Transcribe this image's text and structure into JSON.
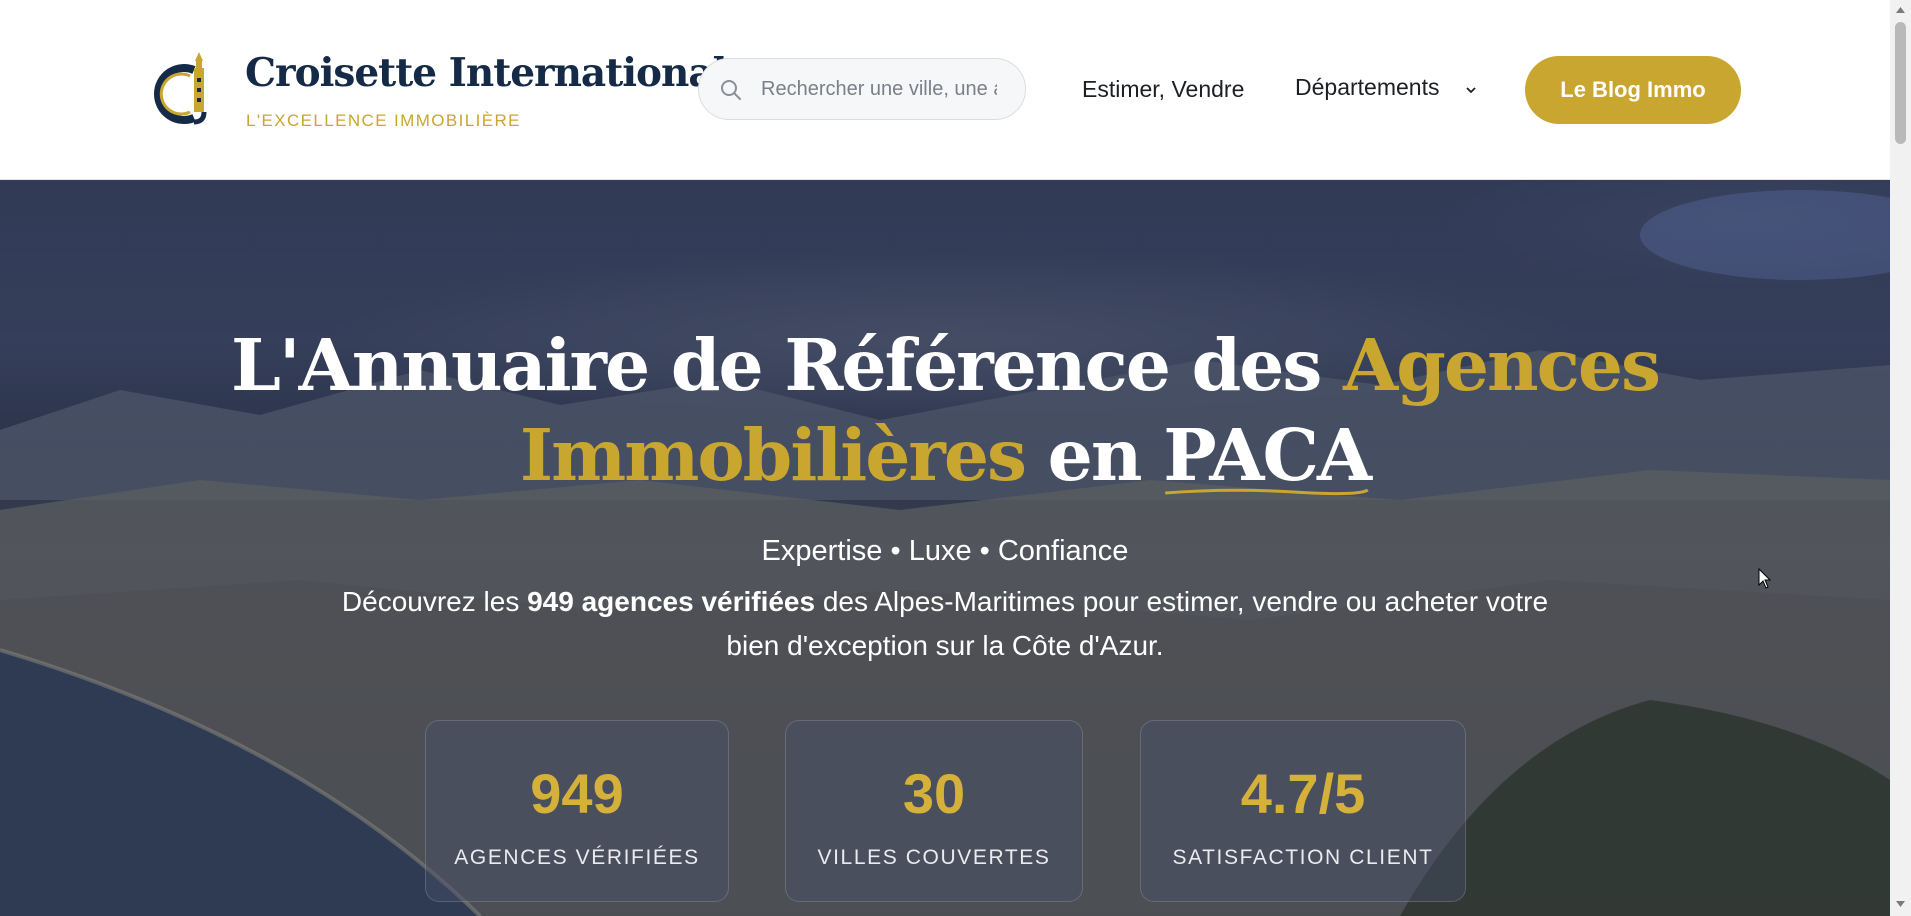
{
  "header": {
    "brand_name": "Croisette International",
    "brand_tagline": "L'EXCELLENCE IMMOBILIÈRE",
    "logo_letters": "CI",
    "search_placeholder": "Rechercher une ville, une agence...",
    "nav": {
      "estimer": "Estimer, Vendre",
      "departements": "Départements"
    },
    "blog_button": "Le Blog Immo"
  },
  "hero": {
    "title_part1": "L'Annuaire de Référence des ",
    "title_gold": "Agences Immobilières",
    "title_part2": " en ",
    "title_underlined": "PACA",
    "tagline": "Expertise • Luxe • Confiance",
    "desc_part1": "Découvrez les ",
    "desc_bold": "949 agences vérifiées",
    "desc_part2": " des Alpes-Maritimes pour estimer, vendre ou acheter votre bien d'exception sur la Côte d'Azur.",
    "stats": [
      {
        "value": "949",
        "label": "AGENCES VÉRIFIÉES"
      },
      {
        "value": "30",
        "label": "VILLES COUVERTES"
      },
      {
        "value": "4.7/5",
        "label": "SATISFACTION CLIENT"
      }
    ]
  },
  "colors": {
    "brand_navy": "#142a47",
    "brand_gold": "#c9a630",
    "hero_overlay": "#18203a"
  },
  "icons": {
    "search": "search-icon",
    "chevron": "chevron-down-icon",
    "logo": "logo-icon"
  }
}
